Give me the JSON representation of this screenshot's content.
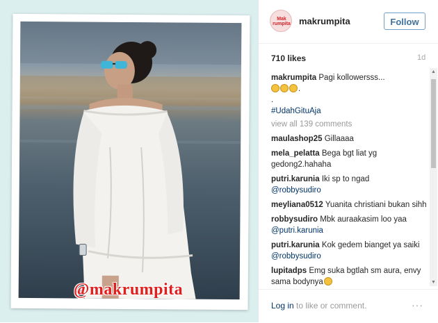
{
  "watermark": "@makrumpita",
  "header": {
    "avatar_text": "Mak rumpita",
    "username": "makrumpita",
    "follow_label": "Follow"
  },
  "post": {
    "likes": "710 likes",
    "time": "1d"
  },
  "caption": {
    "username": "makrumpita",
    "text": "Pagi kollowersss...",
    "dot": ".",
    "hashtag": "#UdahGituAja"
  },
  "view_all": "view all 139 comments",
  "comments": [
    {
      "user": "maulashop25",
      "text": "Gillaaaa"
    },
    {
      "user": "mela_pelatta",
      "text": "Bega bgt liat yg gedong2.hahaha"
    },
    {
      "user": "putri.karunia",
      "text": "Iki sp to ngad",
      "mention": "@robbysudiro"
    },
    {
      "user": "meyliana0512",
      "text": "Yuanita christiani bukan sihh"
    },
    {
      "user": "robbysudiro",
      "text": "Mbk auraakasim loo yaa",
      "mention": "@putri.karunia"
    },
    {
      "user": "putri.karunia",
      "text": "Kok gedem bianget ya saiki",
      "mention": "@robbysudiro"
    },
    {
      "user": "lupitadps",
      "text": "Emg suka bgtlah sm aura, envy sama bodynya"
    }
  ],
  "footer": {
    "login_link": "Log in",
    "login_rest": " to like or comment.",
    "more": "···"
  },
  "icons": {
    "emoji": "grinning-emoji",
    "cry_emoji": "crying-laughing-emoji",
    "more": "more-dots-icon"
  },
  "colors": {
    "follow_border": "#70a0c8",
    "follow_text": "#3f729b",
    "link": "#003569",
    "watermark": "#e0201f"
  }
}
